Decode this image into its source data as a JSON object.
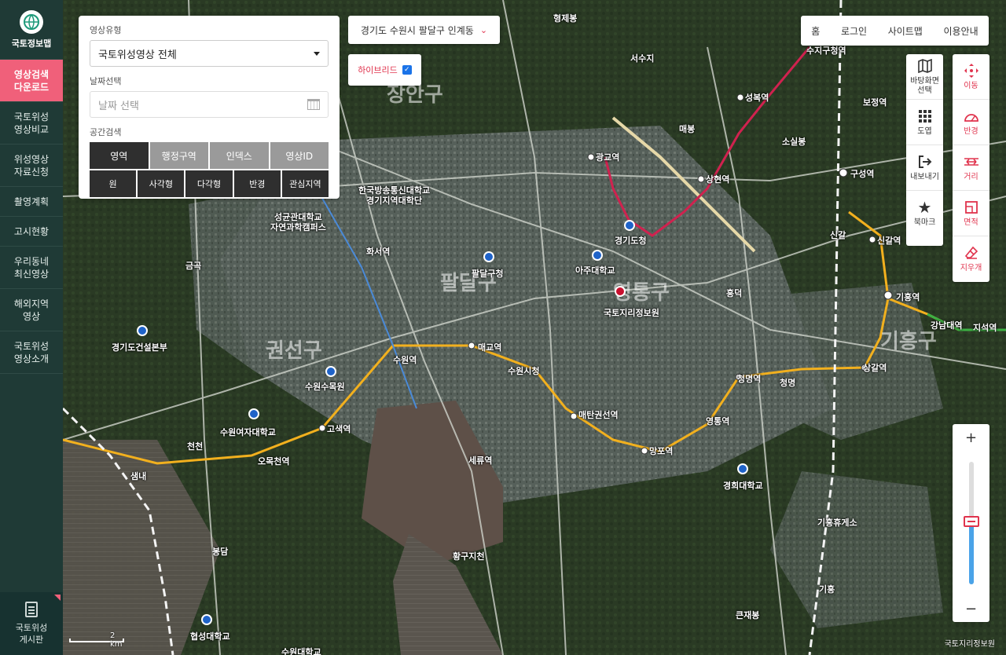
{
  "brand": {
    "name": "국토정보맵"
  },
  "sidebar": {
    "items": [
      {
        "label": "영상검색\n다운로드",
        "active": true
      },
      {
        "label": "국토위성\n영상비교"
      },
      {
        "label": "위성영상\n자료신청"
      },
      {
        "label": "촬영계획"
      },
      {
        "label": "고시현황"
      },
      {
        "label": "우리동네\n최신영상"
      },
      {
        "label": "해외지역\n영상"
      },
      {
        "label": "국토위성\n영상소개"
      }
    ],
    "board_label": "국토위성\n게시판"
  },
  "search": {
    "image_type_label": "영상유형",
    "image_type_value": "국토위성영상 전체",
    "date_label": "날짜선택",
    "date_placeholder": "날짜 선택",
    "spatial_label": "공간검색",
    "tabs": [
      "영역",
      "행정구역",
      "인덱스",
      "영상ID"
    ],
    "shapes": [
      "원",
      "사각형",
      "다각형",
      "반경",
      "관심지역"
    ]
  },
  "location": {
    "text": "경기도 수원시 팔달구 인계동"
  },
  "hybrid": {
    "label": "하이브리드",
    "checked": true
  },
  "top_nav": [
    "홈",
    "로그인",
    "사이트맵",
    "이용안내"
  ],
  "tools_left": [
    {
      "icon": "map-icon",
      "label": "바탕화면\n선택"
    },
    {
      "icon": "grid-icon",
      "label": "도엽"
    },
    {
      "icon": "export-icon",
      "label": "내보내기"
    },
    {
      "icon": "star-icon",
      "label": "북마크"
    }
  ],
  "tools_right": [
    {
      "icon": "move-icon",
      "label": "이동"
    },
    {
      "icon": "radius-icon",
      "label": "반경"
    },
    {
      "icon": "distance-icon",
      "label": "거리"
    },
    {
      "icon": "area-icon",
      "label": "면적"
    },
    {
      "icon": "eraser-icon",
      "label": "지우개"
    }
  ],
  "zoom": {
    "level_fraction": 0.5,
    "plus": "+",
    "minus": "−"
  },
  "scale": {
    "text": "2 km"
  },
  "copyright": "국토지리정보원",
  "map_labels": {
    "districts": [
      "장안구",
      "팔달구",
      "영통구",
      "권선구",
      "기흥구"
    ],
    "stations": [
      "광교역",
      "상현역",
      "성복역",
      "수지구청역",
      "화서역",
      "수원역",
      "매교역",
      "수원시청",
      "매탄권선역",
      "망포역",
      "청명역",
      "영통역",
      "상갈역",
      "기흥역",
      "신갈역",
      "구성역",
      "보정역",
      "강남대역",
      "지석역",
      "고색역",
      "오목천역",
      "세류역",
      "경기도청",
      "흥덕",
      "청명",
      "신갈"
    ],
    "places": [
      "형제봉",
      "매봉",
      "소실봉",
      "한국방송통신대학교\n경기지역대학단",
      "성균관대학교\n자연과학캠퍼스",
      "아주대학교",
      "팔달구청",
      "국토지리정보원",
      "경기도건설본부",
      "수원수목원",
      "수원여자대학교",
      "경희대학교",
      "기흥휴게소",
      "협성대학교",
      "수원대학교",
      "큰재봉",
      "황구지천",
      "금곡",
      "천천",
      "봉담",
      "샘내",
      "기흥",
      "서수지"
    ]
  }
}
